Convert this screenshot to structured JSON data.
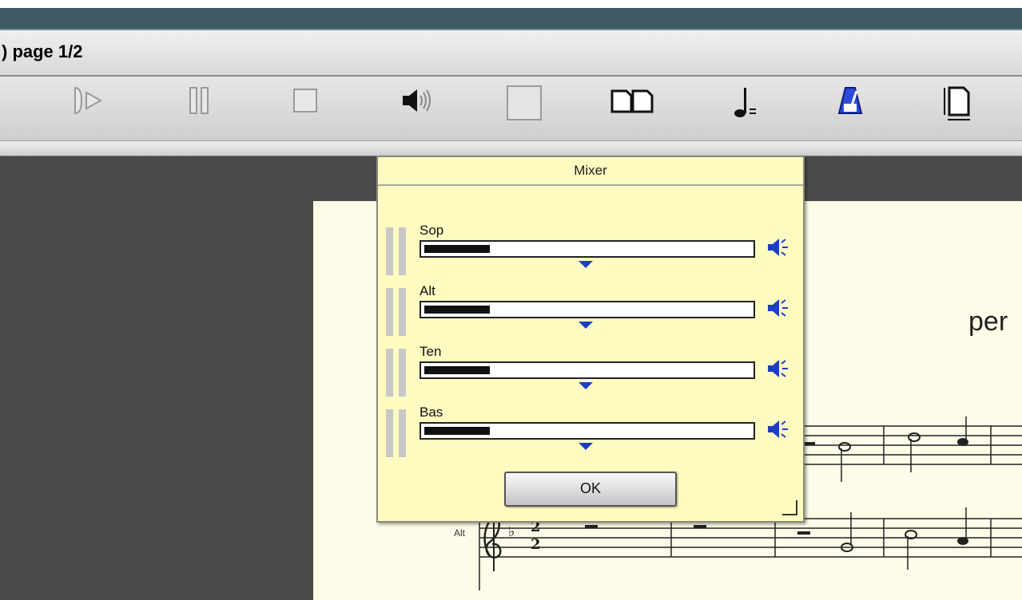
{
  "header": {
    "page_label": ") page 1/2"
  },
  "toolbar": {
    "buttons": [
      {
        "name": "play-icon"
      },
      {
        "name": "pause-icon"
      },
      {
        "name": "stop-icon"
      },
      {
        "name": "volume-icon"
      },
      {
        "name": "blank-icon"
      },
      {
        "name": "two-pages-icon"
      },
      {
        "name": "tempo-note-icon"
      },
      {
        "name": "metronome-icon"
      },
      {
        "name": "page-size-icon"
      }
    ]
  },
  "mixer": {
    "title": "Mixer",
    "channels": [
      {
        "label": "Sop",
        "level": 0.2,
        "pan": 0.5
      },
      {
        "label": "Alt",
        "level": 0.2,
        "pan": 0.5
      },
      {
        "label": "Ten",
        "level": 0.2,
        "pan": 0.5
      },
      {
        "label": "Bas",
        "level": 0.2,
        "pan": 0.5
      }
    ],
    "ok_label": "OK"
  },
  "score": {
    "partial_word": "per",
    "staff_label": "Alt"
  },
  "colors": {
    "titlebar": "#3d5a63",
    "mixer_bg": "#fdfbc0",
    "accent": "#1c3ec4"
  }
}
